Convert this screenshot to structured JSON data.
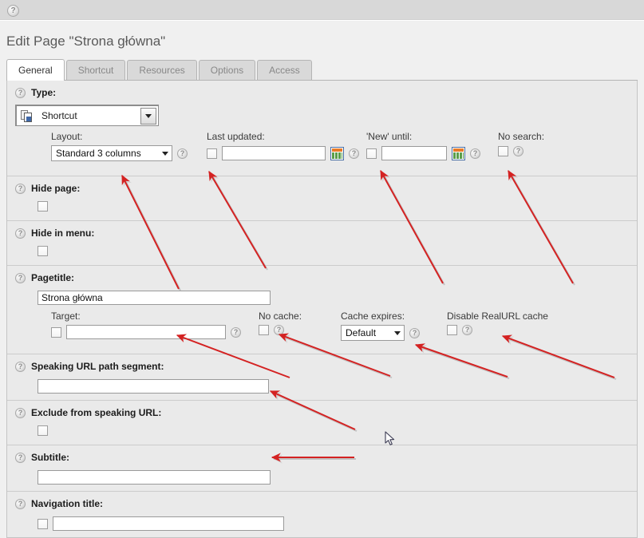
{
  "topbar": {
    "help_icon": "help-icon"
  },
  "header": {
    "title": "Edit Page \"Strona główna\""
  },
  "tabs": [
    {
      "label": "General",
      "active": true
    },
    {
      "label": "Shortcut",
      "active": false
    },
    {
      "label": "Resources",
      "active": false
    },
    {
      "label": "Options",
      "active": false
    },
    {
      "label": "Access",
      "active": false
    }
  ],
  "form": {
    "type": {
      "label": "Type:",
      "value": "Shortcut",
      "icon": "shortcut-document-icon",
      "dropdown_icon": "chevron-down-icon"
    },
    "layout": {
      "label": "Layout:",
      "value": "Standard 3 columns",
      "dropdown_icon": "chevron-down-icon"
    },
    "last_updated": {
      "label": "Last updated:",
      "value": "",
      "checkbox": false,
      "calendar_icon": "calendar-icon"
    },
    "new_until": {
      "label": "'New' until:",
      "value": "",
      "checkbox": false,
      "calendar_icon": "calendar-icon"
    },
    "no_search": {
      "label": "No search:",
      "checkbox": false
    },
    "hide_page": {
      "label": "Hide page:",
      "checkbox": false
    },
    "hide_in_menu": {
      "label": "Hide in menu:",
      "checkbox": false
    },
    "pagetitle": {
      "label": "Pagetitle:",
      "value": "Strona główna"
    },
    "target": {
      "label": "Target:",
      "value": "",
      "checkbox": false
    },
    "no_cache": {
      "label": "No cache:",
      "checkbox": false
    },
    "cache_expires": {
      "label": "Cache expires:",
      "value": "Default",
      "dropdown_icon": "chevron-down-icon"
    },
    "disable_realurl_cache": {
      "label": "Disable RealURL cache",
      "checkbox": false
    },
    "speaking_url_path_segment": {
      "label": "Speaking URL path segment:",
      "value": ""
    },
    "exclude_from_speaking_url": {
      "label": "Exclude from speaking URL:",
      "checkbox": false
    },
    "subtitle": {
      "label": "Subtitle:",
      "value": ""
    },
    "navigation_title": {
      "label": "Navigation title:",
      "value": "",
      "checkbox": false
    }
  },
  "annotations": {
    "arrow_color": "#d42222",
    "count": 9,
    "description": "Red annotation arrows pointing at form fields"
  },
  "colors": {
    "topbar": "#d8d8d8",
    "page_background": "#f0f0f0",
    "panel_background": "#eaeaea",
    "panel_border": "#c4c4c4",
    "active_tab": "#ffffff",
    "inactive_tab": "#d9d9d9",
    "title_text": "#5a5a5a",
    "arrow_red": "#d42222"
  }
}
